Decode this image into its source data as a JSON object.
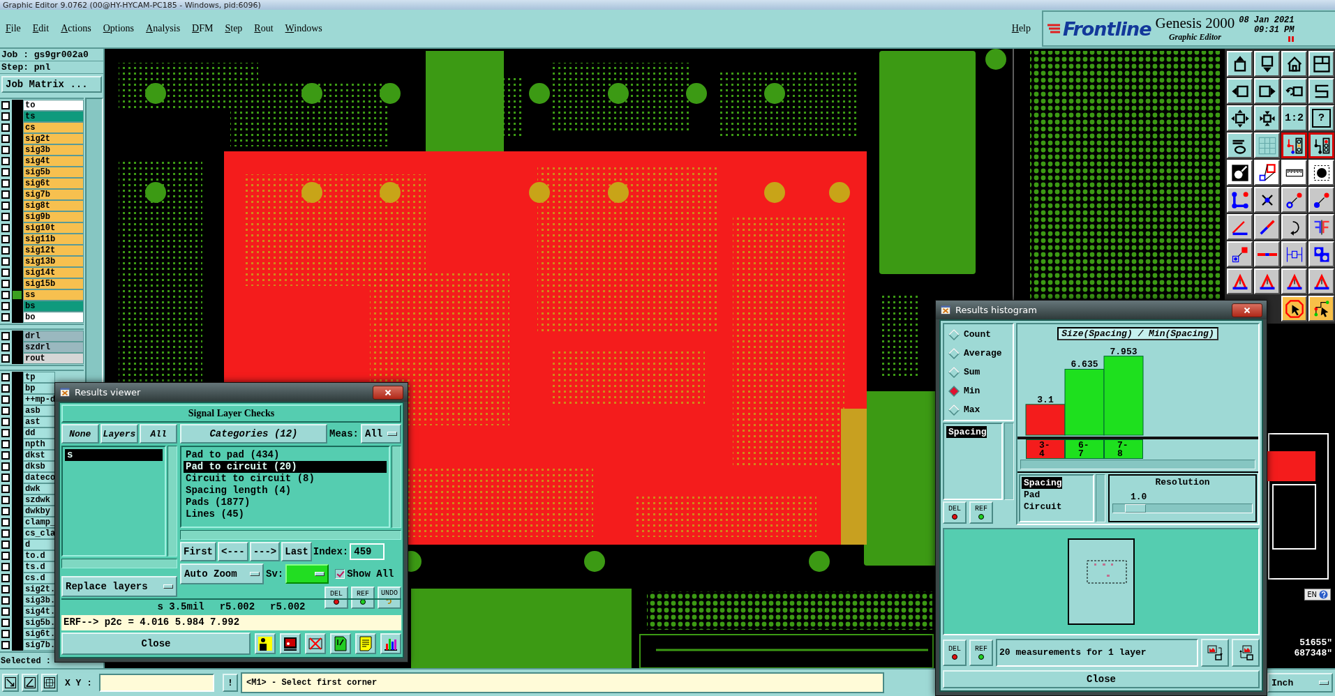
{
  "window": {
    "title": "Graphic Editor 9.0762 (00@HY-HYCAM-PC185 - Windows, pid:6096)"
  },
  "menu": {
    "items": [
      "File",
      "Edit",
      "Actions",
      "Options",
      "Analysis",
      "DFM",
      "Step",
      "Rout",
      "Windows"
    ],
    "help": "Help"
  },
  "branding": {
    "logo": "Frontline",
    "product": "Genesis 2000",
    "module": "Graphic Editor",
    "date": "08 Jan 2021",
    "time": "09:31 PM"
  },
  "job": {
    "job": "Job : gs9gr002a0",
    "step": "Step: pnl",
    "matrix_button": "Job Matrix ..."
  },
  "layer_groups": [
    {
      "layers": [
        {
          "name": "to",
          "color": "#ffffff",
          "checked": false,
          "marked": false
        },
        {
          "name": "ts",
          "color": "#0f9a7d",
          "checked": false,
          "marked": false
        },
        {
          "name": "cs",
          "color": "#f7c04f",
          "checked": false,
          "marked": false
        },
        {
          "name": "sig2t",
          "color": "#f7c04f",
          "checked": false,
          "marked": false
        },
        {
          "name": "sig3b",
          "color": "#f7c04f",
          "checked": false,
          "marked": false
        },
        {
          "name": "sig4t",
          "color": "#f7c04f",
          "checked": false,
          "marked": false
        },
        {
          "name": "sig5b",
          "color": "#f7c04f",
          "checked": false,
          "marked": false
        },
        {
          "name": "sig6t",
          "color": "#f7c04f",
          "checked": false,
          "marked": false
        },
        {
          "name": "sig7b",
          "color": "#f7c04f",
          "checked": false,
          "marked": false
        },
        {
          "name": "sig8t",
          "color": "#f7c04f",
          "checked": false,
          "marked": false
        },
        {
          "name": "sig9b",
          "color": "#f7c04f",
          "checked": false,
          "marked": false
        },
        {
          "name": "sig10t",
          "color": "#f7c04f",
          "checked": false,
          "marked": false
        },
        {
          "name": "sig11b",
          "color": "#f7c04f",
          "checked": false,
          "marked": false
        },
        {
          "name": "sig12t",
          "color": "#f7c04f",
          "checked": false,
          "marked": false
        },
        {
          "name": "sig13b",
          "color": "#f7c04f",
          "checked": false,
          "marked": false
        },
        {
          "name": "sig14t",
          "color": "#f7c04f",
          "checked": false,
          "marked": false
        },
        {
          "name": "sig15b",
          "color": "#f7c04f",
          "checked": false,
          "marked": false
        },
        {
          "name": "ss",
          "color": "#f7c04f",
          "checked": false,
          "marked": true
        },
        {
          "name": "bs",
          "color": "#0f9a7d",
          "checked": false,
          "marked": false
        },
        {
          "name": "bo",
          "color": "#ffffff",
          "checked": false,
          "marked": false
        }
      ]
    },
    {
      "layers": [
        {
          "name": "drl",
          "color": "#9ab8bf",
          "checked": false,
          "marked": false
        },
        {
          "name": "szdrl",
          "color": "#9ab8bf",
          "checked": false,
          "marked": false
        },
        {
          "name": "rout",
          "color": "#d6d6d6",
          "checked": false,
          "marked": false
        }
      ]
    },
    {
      "layers": [
        {
          "name": "tp",
          "color": "#a6e2de",
          "checked": false,
          "marked": false
        },
        {
          "name": "bp",
          "color": "#a6e2de",
          "checked": false,
          "marked": false
        },
        {
          "name": "++mp-d",
          "color": "#a6e2de",
          "checked": false,
          "marked": false
        },
        {
          "name": "asb",
          "color": "#a6e2de",
          "checked": false,
          "marked": false
        },
        {
          "name": "ast",
          "color": "#a6e2de",
          "checked": false,
          "marked": false
        },
        {
          "name": "dd",
          "color": "#a6e2de",
          "checked": false,
          "marked": false
        },
        {
          "name": "npth",
          "color": "#a6e2de",
          "checked": false,
          "marked": false
        },
        {
          "name": "dkst",
          "color": "#a6e2de",
          "checked": false,
          "marked": false
        },
        {
          "name": "dksb",
          "color": "#a6e2de",
          "checked": false,
          "marked": false
        },
        {
          "name": "dateco",
          "color": "#a6e2de",
          "checked": false,
          "marked": false
        },
        {
          "name": "dwk",
          "color": "#a6e2de",
          "checked": false,
          "marked": false
        },
        {
          "name": "szdwk",
          "color": "#a6e2de",
          "checked": false,
          "marked": false
        },
        {
          "name": "dwkby",
          "color": "#a6e2de",
          "checked": false,
          "marked": false
        },
        {
          "name": "clamp_",
          "color": "#a6e2de",
          "checked": false,
          "marked": false
        },
        {
          "name": "cs_cla",
          "color": "#a6e2de",
          "checked": false,
          "marked": false
        },
        {
          "name": "d",
          "color": "#a6e2de",
          "checked": false,
          "marked": false
        },
        {
          "name": "to.d",
          "color": "#a6e2de",
          "checked": false,
          "marked": false
        },
        {
          "name": "ts.d",
          "color": "#a6e2de",
          "checked": false,
          "marked": false
        },
        {
          "name": "cs.d",
          "color": "#a6e2de",
          "checked": false,
          "marked": false
        },
        {
          "name": "sig2t.",
          "color": "#a6e2de",
          "checked": false,
          "marked": false
        },
        {
          "name": "sig3b.",
          "color": "#a6e2de",
          "checked": false,
          "marked": false
        },
        {
          "name": "sig4t.",
          "color": "#a6e2de",
          "checked": false,
          "marked": false
        },
        {
          "name": "sig5b.",
          "color": "#a6e2de",
          "checked": false,
          "marked": false
        },
        {
          "name": "sig6t.",
          "color": "#a6e2de",
          "checked": false,
          "marked": false
        },
        {
          "name": "sig7b.",
          "color": "#a6e2de",
          "checked": false,
          "marked": false
        }
      ]
    }
  ],
  "selected_label": "Selected :",
  "toolbar": [
    {
      "kind": "view",
      "buttons": [
        {
          "kind": "box_up",
          "on": false
        },
        {
          "kind": "box_down",
          "on": false
        },
        {
          "kind": "house",
          "on": false
        },
        {
          "kind": "windows",
          "on": false
        },
        {
          "kind": "box_left",
          "on": false
        },
        {
          "kind": "box_right",
          "on": false
        },
        {
          "kind": "undo_box",
          "on": false
        },
        {
          "kind": "s_curve",
          "on": false
        },
        {
          "kind": "expand",
          "on": false
        },
        {
          "kind": "shrink",
          "on": false
        },
        {
          "kind": "text",
          "label": "1:2",
          "on": false
        },
        {
          "kind": "text",
          "label": "?",
          "on": false
        },
        {
          "kind": "tools",
          "on": false
        },
        {
          "kind": "grid",
          "on": false
        },
        {
          "kind": "circuit",
          "on": true
        },
        {
          "kind": "circuit_red",
          "on": true
        }
      ]
    },
    {
      "kind": "measure",
      "buttons": [
        {
          "kind": "zoom_shape",
          "on": false
        },
        {
          "kind": "two_squares",
          "on": false
        },
        {
          "kind": "ruler",
          "on": false
        },
        {
          "kind": "dashed_circle",
          "on": false
        }
      ]
    },
    {
      "kind": "edit",
      "buttons": [
        {
          "kind": "nodes",
          "on": false
        },
        {
          "kind": "x_mark",
          "on": false
        },
        {
          "kind": "p2p_hollow",
          "on": false
        },
        {
          "kind": "p2p_solid",
          "on": false
        },
        {
          "kind": "angle_line",
          "on": false
        },
        {
          "kind": "diag_line",
          "on": false
        },
        {
          "kind": "curve_arrow",
          "on": false
        },
        {
          "kind": "mirror",
          "on": false
        },
        {
          "kind": "square_link",
          "on": false
        },
        {
          "kind": "h_line",
          "on": false
        },
        {
          "kind": "measure_box",
          "on": false
        },
        {
          "kind": "overlap",
          "on": false
        },
        {
          "kind": "arch",
          "on": false
        },
        {
          "kind": "arch",
          "on": false
        },
        {
          "kind": "arch",
          "on": false
        },
        {
          "kind": "arch",
          "on": false
        }
      ]
    },
    {
      "kind": "select",
      "buttons": [
        {
          "kind": "octagon_pointer",
          "on": false
        },
        {
          "kind": "path_pointer",
          "on": false
        }
      ]
    }
  ],
  "canvas": {
    "language": "EN",
    "readout": [
      "51655\"",
      "687348\""
    ]
  },
  "results_viewer": {
    "title": "Results viewer",
    "header": "Signal Layer Checks",
    "layer_filters": [
      "None",
      "Layers",
      "All"
    ],
    "layers": [
      {
        "name": "s",
        "selected": true
      }
    ],
    "categories_button": "Categories (12)",
    "meas_label": "Meas:",
    "meas_value": "All",
    "categories": [
      {
        "label": "Pad to pad (434)",
        "selected": false
      },
      {
        "label": "Pad to circuit (20)",
        "selected": true
      },
      {
        "label": "Circuit to circuit (8)",
        "selected": false
      },
      {
        "label": "Spacing length (4)",
        "selected": false
      },
      {
        "label": "Pads (1877)",
        "selected": false
      },
      {
        "label": "Lines (45)",
        "selected": false
      }
    ],
    "nav": [
      "First",
      "<---",
      "--->",
      "Last"
    ],
    "index_label": "Index:",
    "index_value": "459",
    "zoom_mode": "Auto Zoom",
    "sv_label": "Sv:",
    "show_all": {
      "label": "Show All",
      "checked": true
    },
    "actions": [
      {
        "label": "DEL",
        "kind": "delete"
      },
      {
        "label": "REF",
        "kind": "reference"
      },
      {
        "label": "UNDO",
        "kind": "undo"
      }
    ],
    "replace_mode": "Replace layers",
    "measurement": [
      "s 3.5mil",
      "r5.002",
      "r5.002"
    ],
    "erf": "ERF--> p2c = 4.016 5.984 7.992",
    "close": "Close"
  },
  "histogram": {
    "title": "Results histogram",
    "modes": [
      {
        "label": "Count",
        "selected": false
      },
      {
        "label": "Average",
        "selected": false
      },
      {
        "label": "Sum",
        "selected": false
      },
      {
        "label": "Min",
        "selected": true
      },
      {
        "label": "Max",
        "selected": false
      }
    ],
    "list": [
      {
        "label": "Spacing",
        "selected": true
      }
    ],
    "actions": [
      {
        "label": "DEL",
        "kind": "delete"
      },
      {
        "label": "REF",
        "kind": "reference"
      }
    ],
    "chart_data": {
      "type": "bar",
      "title": "Size(Spacing) / Min(Spacing)",
      "categories": [
        "3-4",
        "6-7",
        "7-8"
      ],
      "series": [
        {
          "color": "#f41c1c",
          "values": [
            3.1,
            null,
            null
          ]
        },
        {
          "color": "#1ee01e",
          "values": [
            null,
            6.635,
            7.953
          ]
        }
      ],
      "stacked": true,
      "data_labels": true
    },
    "attributes": [
      {
        "label": "Spacing",
        "selected": true
      },
      {
        "label": "Pad",
        "selected": false
      },
      {
        "label": "Circuit",
        "selected": false
      }
    ],
    "resolution_label": "Resolution",
    "resolution_value": "1.0",
    "resolution": {
      "level": 0.1
    },
    "status_actions": [
      {
        "label": "DEL",
        "kind": "delete"
      },
      {
        "label": "REF",
        "kind": "reference"
      }
    ],
    "summary": "20 measurements for 1 layer",
    "close": "Close"
  },
  "status_bar": {
    "xy_label": "X Y :",
    "bang": "!",
    "message": "<M1> - Select first corner",
    "units": "Inch"
  }
}
